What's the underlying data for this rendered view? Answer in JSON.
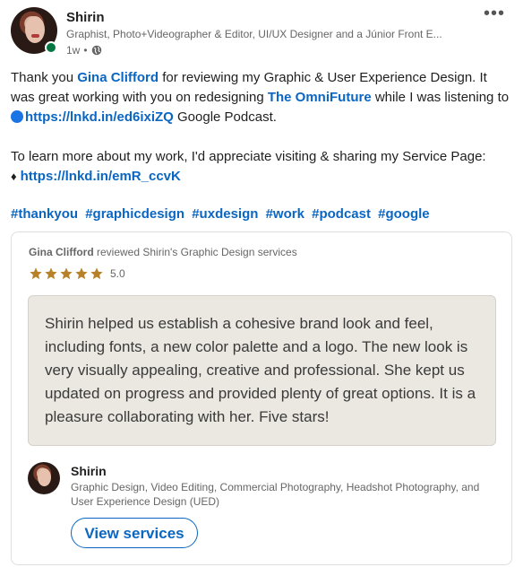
{
  "post": {
    "author": {
      "name": "Shirin",
      "headline": "Graphist, Photo+Videographer & Editor, UI/UX Designer and a Júnior Front E...",
      "time": "1w",
      "separator": "•",
      "visibility_icon": "globe-icon",
      "online_status_color": "#057642"
    },
    "more_label": "•••",
    "text": {
      "p1_a": "Thank you ",
      "mention1": "Gina Clifford",
      "p1_b": " for reviewing my Graphic & User Experience Design. It was great working with you on redesigning ",
      "mention2": "The OmniFuture",
      "p1_c": " while I was listening to ",
      "link1": "https://lnkd.in/ed6ixiZQ",
      "p1_d": " Google Podcast.",
      "p2_a": "To learn more about my work, I'd appreciate visiting & sharing my Service Page:",
      "diamond": "♦",
      "link2": "https://lnkd.in/emR_ccvK"
    },
    "hashtags": [
      "#thankyou",
      "#graphicdesign",
      "#uxdesign",
      "#work",
      "#podcast",
      "#google"
    ]
  },
  "review": {
    "reviewer": "Gina Clifford",
    "reviewed_text": " reviewed Shirin's Graphic Design services",
    "stars": 5,
    "rating": "5.0",
    "star_color": "#b7812a",
    "quote": "Shirin helped us establish a cohesive brand look and feel, including fonts, a new color palette and a logo. The new look is very visually appealing, creative and professional. She kept us updated on progress and provided plenty of great options. It is a pleasure collaborating with her. Five stars!",
    "provider": {
      "name": "Shirin",
      "skills": "Graphic Design, Video Editing, Commercial Photography, Headshot Photography, and User Experience Design (UED)",
      "button_label": "View services"
    }
  },
  "colors": {
    "link": "#0a66c2",
    "quote_bg": "#ebe7e1"
  }
}
